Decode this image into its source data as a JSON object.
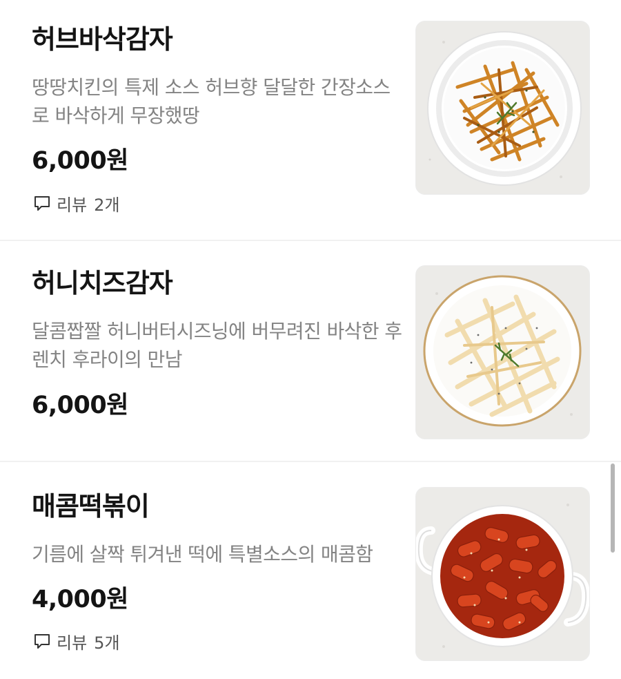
{
  "menu": {
    "items": [
      {
        "name": "허브바삭감자",
        "description": "땅땅치킨의 특제 소스 허브향 달달한 간장소스로 바삭하게 무장했땅",
        "price": "6,000원",
        "review_label": "리뷰",
        "review_count": "2개",
        "image_icon": "herb-fries-photo"
      },
      {
        "name": "허니치즈감자",
        "description": "달콤짭짤 허니버터시즈닝에 버무려진 바삭한 후렌치 후라이의 만남",
        "price": "6,000원",
        "image_icon": "honey-cheese-fries-photo"
      },
      {
        "name": "매콤떡볶이",
        "description": "기름에 살짝 튀겨낸 떡에 특별소스의 매콤함",
        "price": "4,000원",
        "review_label": "리뷰",
        "review_count": "5개",
        "image_icon": "tteokbokki-photo"
      }
    ]
  },
  "icons": {
    "review": "speech-bubble-icon"
  },
  "colors": {
    "text_primary": "#141414",
    "text_secondary": "#838383",
    "divider": "#f1f1f1",
    "scrollbar": "#b6b6b6"
  }
}
